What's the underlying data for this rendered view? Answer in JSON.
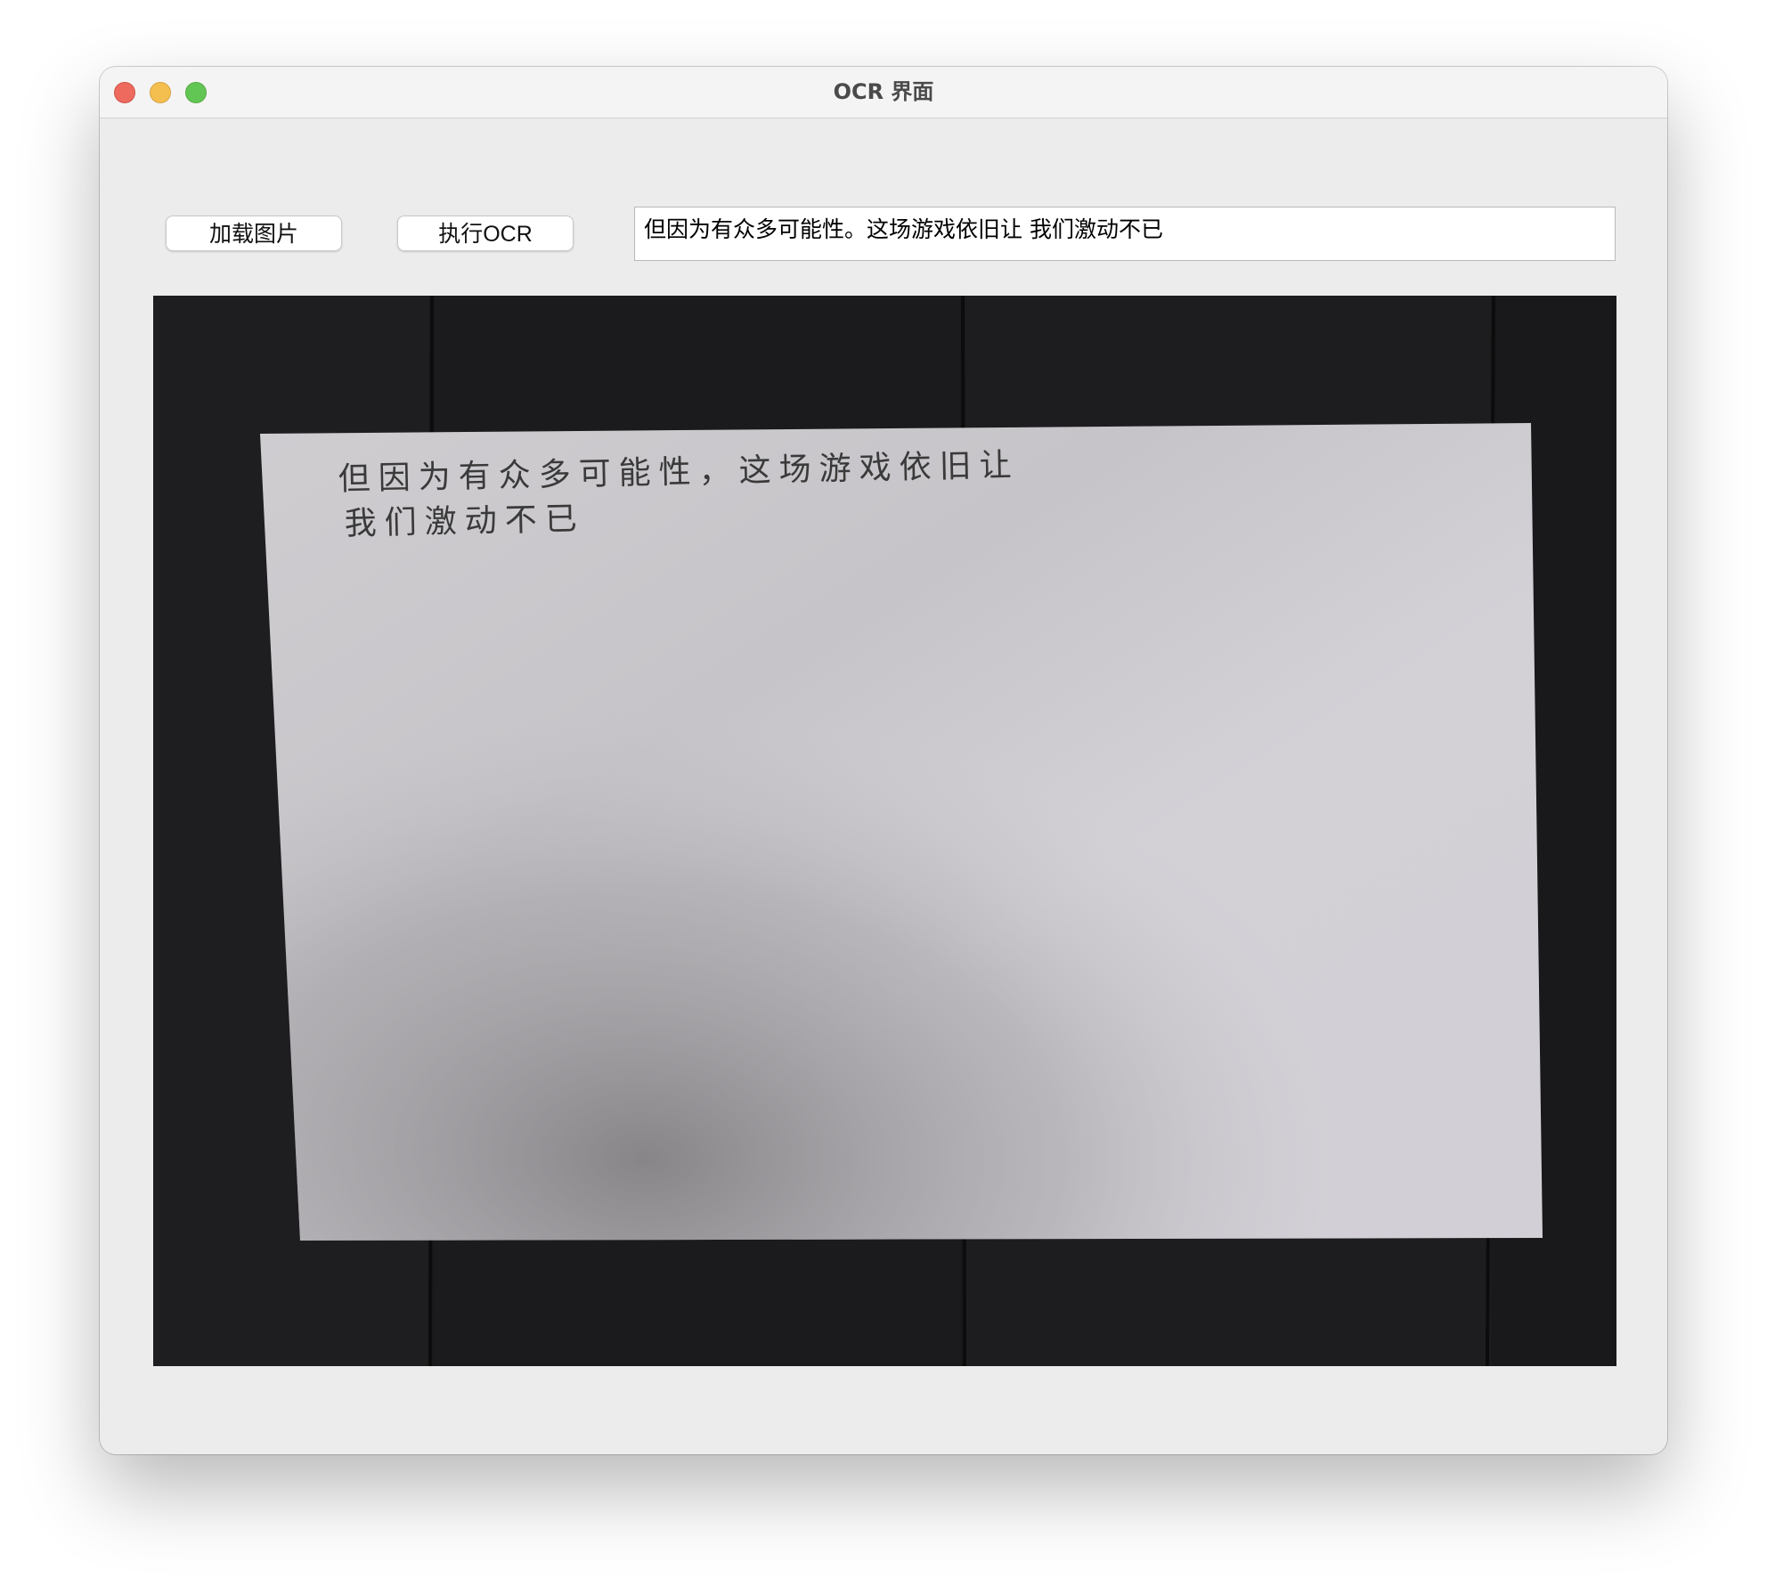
{
  "window": {
    "title": "OCR 界面"
  },
  "toolbar": {
    "load_label": "加载图片",
    "ocr_label": "执行OCR"
  },
  "result": {
    "text": "但因为有众多可能性。这场游戏依旧让 我们激动不已"
  },
  "photo": {
    "handwritten_lines": [
      "但因为有众多可能性，这场游戏依旧让",
      "我们激动不已"
    ]
  },
  "colors": {
    "close": "#ee6a5f",
    "minimize": "#f5bf4f",
    "zoom": "#62c655",
    "window_bg": "#ececec",
    "photo_bg": "#1a1a1c",
    "paper": "#d4d2d6"
  },
  "icons": {
    "close": "close-icon",
    "minimize": "minimize-icon",
    "zoom": "zoom-icon"
  }
}
